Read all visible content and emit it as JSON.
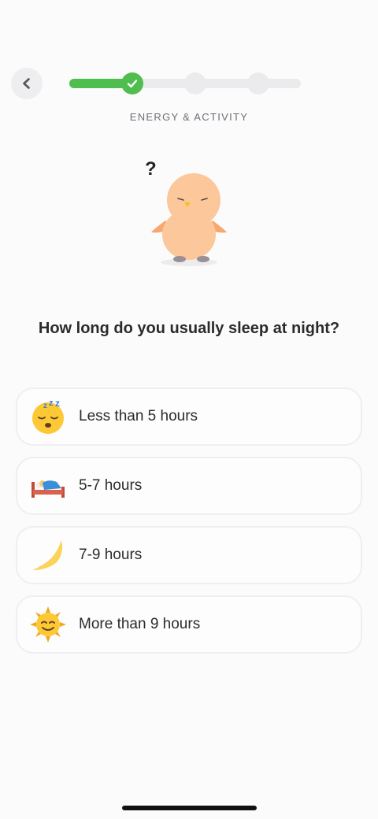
{
  "header": {
    "back_icon": "chevron-left-icon",
    "progress": {
      "steps": 4,
      "completed_steps": 1,
      "fraction": 0.27
    },
    "section_label": "ENERGY & ACTIVITY"
  },
  "mascot": {
    "question_mark": "?"
  },
  "question": "How long do you usually sleep at night?",
  "options": [
    {
      "label": "Less than 5 hours",
      "icon": "sleeping-face-icon"
    },
    {
      "label": "5-7 hours",
      "icon": "bed-icon"
    },
    {
      "label": "7-9 hours",
      "icon": "crescent-moon-icon"
    },
    {
      "label": "More than 9 hours",
      "icon": "sun-face-icon"
    }
  ],
  "colors": {
    "accent_green": "#4fbe4f",
    "track_gray": "#ebeaed",
    "mascot_peach": "#fcc79a",
    "text_dark": "#2b2b2b"
  }
}
